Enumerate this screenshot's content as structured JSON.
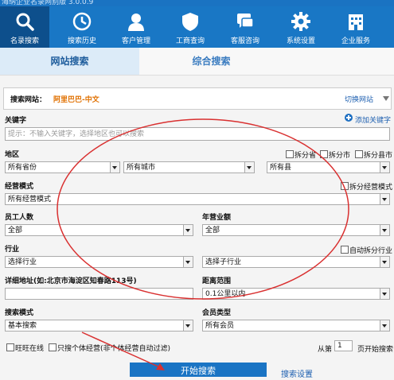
{
  "app_title": "海纳企业名录网别版 3.0.0.9",
  "nav": [
    {
      "label": "名录搜索",
      "icon": "search-icon"
    },
    {
      "label": "搜索历史",
      "icon": "clock-icon"
    },
    {
      "label": "客户管理",
      "icon": "customer-icon"
    },
    {
      "label": "工商查询",
      "icon": "shield-icon"
    },
    {
      "label": "客服咨询",
      "icon": "chat-icon"
    },
    {
      "label": "系统设置",
      "icon": "gear-icon"
    },
    {
      "label": "企业服务",
      "icon": "building-icon"
    }
  ],
  "tabs": [
    "网站搜索",
    "综合搜索"
  ],
  "site": {
    "label": "搜索网站：",
    "value": "阿里巴巴-中文",
    "switch_label": "切换网站"
  },
  "keyword": {
    "label": "关键字",
    "add_label": "添加关键字",
    "placeholder": "提示：不输入关键字，选择地区也可以搜索"
  },
  "region": {
    "label": "地区",
    "split_province": "拆分省",
    "split_city": "拆分市",
    "split_county": "拆分县市",
    "province": "所有省份",
    "city": "所有城市",
    "county": "所有县"
  },
  "mode": {
    "label": "经营模式",
    "split_label": "拆分经营模式",
    "value": "所有经营模式"
  },
  "staff": {
    "label": "员工人数",
    "value": "全部"
  },
  "revenue": {
    "label": "年营业额",
    "value": "全部"
  },
  "industry": {
    "label": "行业",
    "auto_split_label": "自动拆分行业",
    "value": "选择行业",
    "sub_value": "选择子行业"
  },
  "address": {
    "label": "详细地址(如:北京市海淀区知春路113号)",
    "value": ""
  },
  "distance": {
    "label": "距离范围",
    "value": "0.1公里以内"
  },
  "search_mode": {
    "label": "搜索模式",
    "value": "基本搜索"
  },
  "member": {
    "label": "会员类型",
    "value": "所有会员"
  },
  "options": {
    "online_label": "旺旺在线",
    "individual_label": "只搜个体经营(非个体经营自动过滤)"
  },
  "pager": {
    "from_label": "从第",
    "page": "1",
    "start_label": "页开始搜索"
  },
  "buttons": {
    "start": "开始搜索",
    "settings": "搜索设置"
  },
  "colors": {
    "nav_bg": "#1977c5",
    "nav_active": "#0d4f8c",
    "site_value": "#e07000",
    "annotation": "#d93030"
  }
}
